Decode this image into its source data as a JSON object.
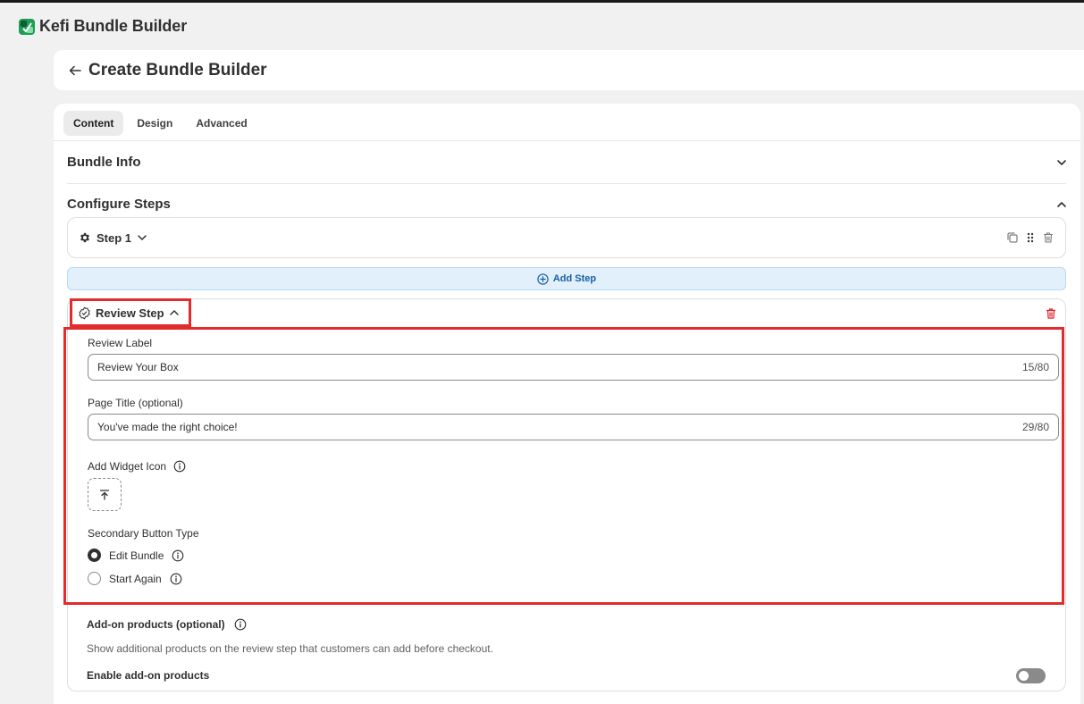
{
  "app": {
    "title": "Kefi Bundle Builder",
    "logo_icon": "kefi-logo-icon"
  },
  "header": {
    "back_icon": "arrow-left-icon",
    "title": "Create Bundle Builder"
  },
  "tabs": [
    {
      "label": "Content",
      "active": true
    },
    {
      "label": "Design",
      "active": false
    },
    {
      "label": "Advanced",
      "active": false
    }
  ],
  "sections": {
    "bundle_info": {
      "title": "Bundle Info",
      "expanded": false
    },
    "configure_steps": {
      "title": "Configure Steps",
      "expanded": true
    }
  },
  "step1": {
    "label": "Step 1",
    "icons": [
      "gear-icon",
      "chevron-down-icon",
      "duplicate-icon",
      "drag-handle-icon",
      "trash-icon"
    ]
  },
  "add_step": {
    "label": "Add Step",
    "icon": "plus-circle-icon"
  },
  "review_step": {
    "label": "Review Step",
    "review_label": {
      "label": "Review Label",
      "value": "Review Your Box",
      "counter": "15/80"
    },
    "page_title": {
      "label": "Page Title (optional)",
      "value": "You've made the right choice!",
      "counter": "29/80"
    },
    "widget_icon": {
      "label": "Add Widget Icon"
    },
    "secondary_button": {
      "label": "Secondary Button Type",
      "options": [
        {
          "label": "Edit Bundle",
          "selected": true
        },
        {
          "label": "Start Again",
          "selected": false
        }
      ]
    },
    "addon": {
      "title": "Add-on products (optional)",
      "description": "Show additional products on the review step that customers can add before checkout.",
      "enable_label": "Enable add-on products",
      "enabled": false
    }
  },
  "colors": {
    "highlight": "#e32b2b",
    "danger": "#e51c23",
    "accent_blue": "#1a5fa0",
    "add_step_bg": "#e1f0fb"
  }
}
